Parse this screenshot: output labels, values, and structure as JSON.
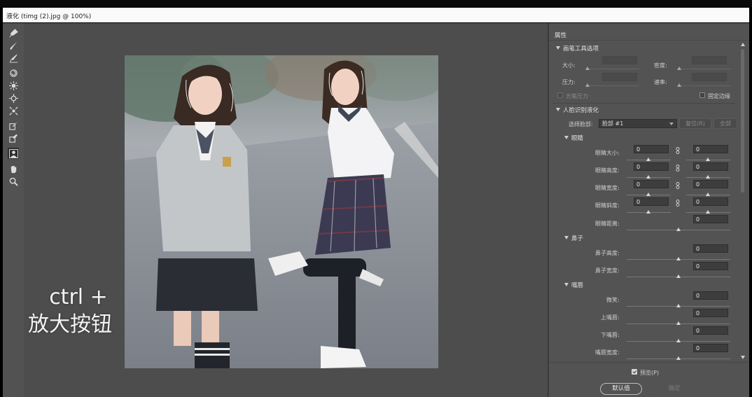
{
  "window": {
    "title": "液化 (timg (2).jpg @ 100%)"
  },
  "tools": [
    {
      "name": "forward-warp-tool-icon"
    },
    {
      "name": "reconstruct-tool-icon"
    },
    {
      "name": "smooth-tool-icon"
    },
    {
      "name": "twirl-tool-icon"
    },
    {
      "name": "pucker-tool-icon"
    },
    {
      "name": "bloat-tool-icon"
    },
    {
      "name": "push-left-tool-icon"
    },
    {
      "name": "freeze-mask-tool-icon"
    },
    {
      "name": "thaw-mask-tool-icon"
    },
    {
      "name": "face-tool-icon"
    },
    {
      "name": "hand-tool-icon"
    },
    {
      "name": "zoom-tool-icon"
    }
  ],
  "overlay": {
    "line1": "ctrl +",
    "line2": "放大按钮"
  },
  "panel": {
    "title": "属性",
    "brush_section": {
      "title": "画笔工具选项",
      "size_label": "大小:",
      "density_label": "密度:",
      "pressure_label": "压力:",
      "rate_label": "速率:",
      "stylus_pressure_label": "光笔压力",
      "pin_edges_label": "固定边缘",
      "pin_edges_checked": false,
      "stylus_checked": false
    },
    "face_section": {
      "title": "人脸识别液化",
      "select_face_label": "选择脸部:",
      "select_face_value": "脸部 #1",
      "reset_button": "复位(R)",
      "all_button": "全部",
      "eyes": {
        "title": "眼睛",
        "rows": [
          {
            "label": "眼睛大小:",
            "left": "0",
            "right": "0",
            "linked": true
          },
          {
            "label": "眼睛高度:",
            "left": "0",
            "right": "0",
            "linked": true
          },
          {
            "label": "眼睛宽度:",
            "left": "0",
            "right": "0",
            "linked": true
          },
          {
            "label": "眼睛斜度:",
            "left": "0",
            "right": "0",
            "linked": true
          },
          {
            "label": "眼睛距离:",
            "value": "0"
          }
        ]
      },
      "nose": {
        "title": "鼻子",
        "rows": [
          {
            "label": "鼻子高度:",
            "value": "0"
          },
          {
            "label": "鼻子宽度:",
            "value": "0"
          }
        ]
      },
      "mouth": {
        "title": "嘴唇",
        "rows": [
          {
            "label": "微笑:",
            "value": "0"
          },
          {
            "label": "上嘴唇:",
            "value": "0"
          },
          {
            "label": "下嘴唇:",
            "value": "0"
          },
          {
            "label": "嘴唇宽度:",
            "value": "0"
          }
        ]
      }
    },
    "preview_label": "预览(P)",
    "preview_checked": true,
    "default_button": "默认值",
    "ok_button": "确定"
  }
}
